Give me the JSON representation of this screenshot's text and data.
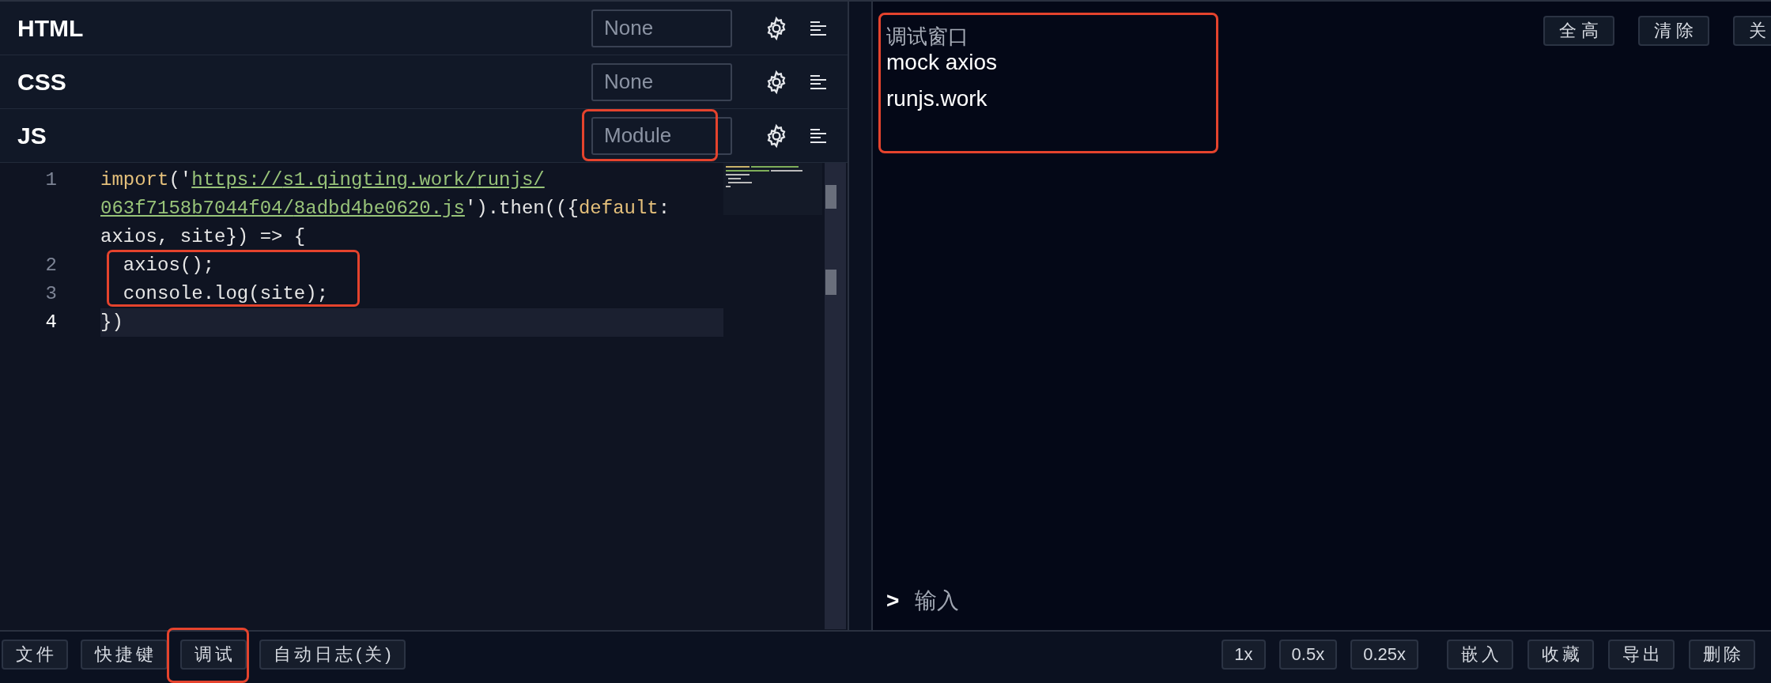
{
  "editors": [
    {
      "label": "HTML",
      "preprocessor": "None",
      "highlighted": false
    },
    {
      "label": "CSS",
      "preprocessor": "None",
      "highlighted": false
    },
    {
      "label": "JS",
      "preprocessor": "Module",
      "highlighted": true
    }
  ],
  "code": {
    "lines": [
      {
        "number": "1",
        "current": false,
        "highlighted": false,
        "tokens": [
          {
            "text": "import",
            "kind": "keyword"
          },
          {
            "text": "('",
            "kind": "plain"
          },
          {
            "text": "https://s1.qingting.work/runjs/063f7158b7044f04/8adbd4be0620.js",
            "kind": "link"
          },
          {
            "text": "').then(({",
            "kind": "plain"
          },
          {
            "text": "default",
            "kind": "keyword"
          },
          {
            "text": ": axios, site}) => {",
            "kind": "plain"
          }
        ]
      },
      {
        "number": "2",
        "current": false,
        "highlighted": true,
        "tokens": [
          {
            "text": "  axios();",
            "kind": "plain"
          }
        ]
      },
      {
        "number": "3",
        "current": false,
        "highlighted": true,
        "tokens": [
          {
            "text": "  console.log(site);",
            "kind": "plain"
          }
        ]
      },
      {
        "number": "4",
        "current": true,
        "highlighted": false,
        "tokens": [
          {
            "text": "})",
            "kind": "plain"
          }
        ]
      }
    ]
  },
  "console": {
    "title": "调试窗口",
    "logs": [
      "mock axios",
      "runjs.work"
    ],
    "highlighted": true,
    "buttons": [
      "全高",
      "清除",
      "关"
    ],
    "prompt": ">",
    "input_placeholder": "输入"
  },
  "footer": {
    "left_buttons": [
      {
        "label": "文件",
        "highlighted": false
      },
      {
        "label": "快捷键",
        "highlighted": false
      },
      {
        "label": "调试",
        "highlighted": true
      },
      {
        "label": "自动日志(关)",
        "highlighted": false
      }
    ],
    "zoom_buttons": [
      "1x",
      "0.5x",
      "0.25x"
    ],
    "action_buttons": [
      "嵌入",
      "收藏",
      "导出",
      "删除"
    ]
  }
}
